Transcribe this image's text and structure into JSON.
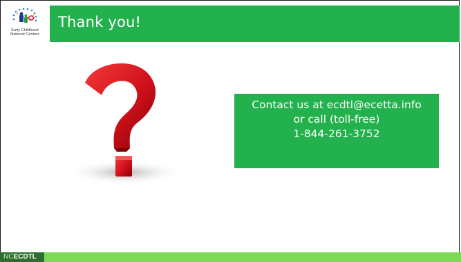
{
  "slide": {
    "title": "Thank you!",
    "contact_lines": [
      "Contact us at ecdtl@ecetta.info",
      "or call (toll-free)",
      "1-844-261-3752"
    ]
  },
  "logo": {
    "line1": "Early Childhood",
    "line2": "National Centers"
  },
  "footer": {
    "brand_prefix": "NC",
    "brand_suffix": "ECDTL"
  },
  "colors": {
    "accent_green": "#22b14c",
    "footer_green": "#7ed957",
    "question_red": "#d0101a"
  },
  "icons": {
    "main_graphic": "question-mark-icon",
    "logo": "ecnc-logo-icon"
  }
}
